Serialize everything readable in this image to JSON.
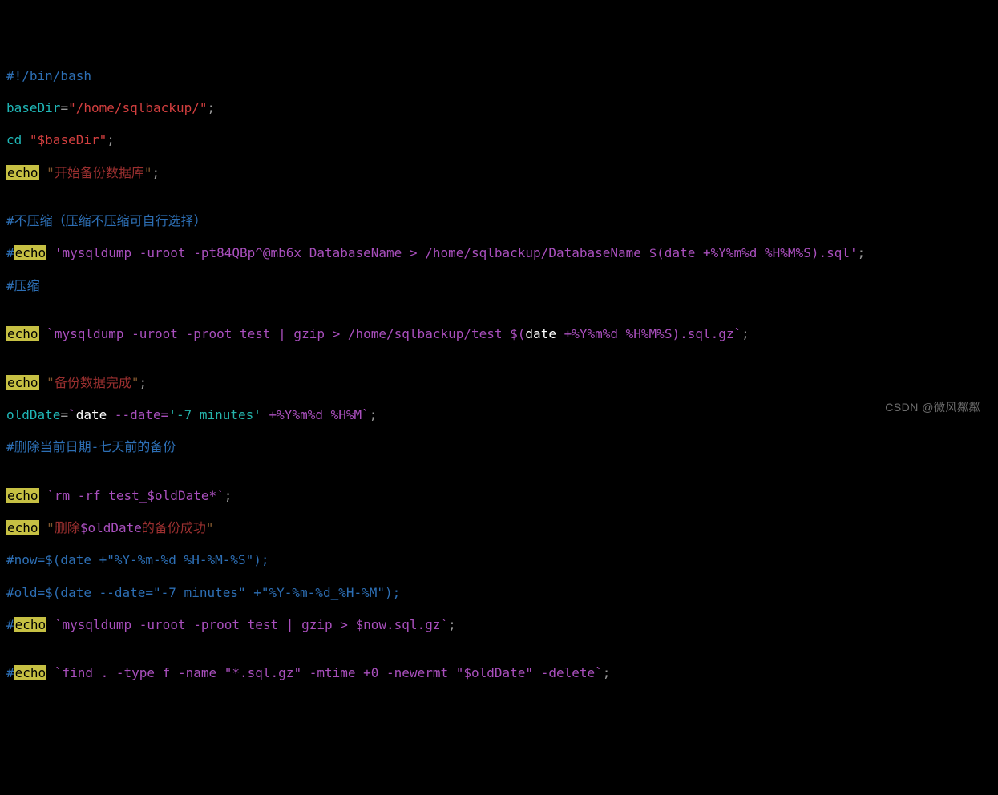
{
  "l1": {
    "shebang": "#!/bin/bash"
  },
  "l2": {
    "var": "baseDir",
    "eq": "=",
    "val": "\"/home/sqlbackup/\"",
    "semi": ";"
  },
  "l3": {
    "cd": "cd ",
    "arg": "\"$baseDir\"",
    "semi": ";"
  },
  "l4": {
    "echo": "echo",
    "sp": " ",
    "q1": "\"",
    "msg": "开始备份数据库",
    "q2": "\"",
    "semi": ";"
  },
  "blank1": "",
  "l6": {
    "text": "#不压缩（压缩不压缩可自行选择）"
  },
  "l7": {
    "hash": "#",
    "echo": "echo",
    "sp": " ",
    "str": "'mysqldump -uroot -pt84QBp^@mb6x DatabaseName > /home/sqlbackup/DatabaseName_$(date +%Y%m%d_%H%M%S).sql'",
    "semi": ";"
  },
  "l8": {
    "text": "#压缩"
  },
  "blank2": "",
  "l10": {
    "echo": "echo",
    "sp": " ",
    "bt1": "`",
    "cmd": "mysqldump -uroot -proot test | gzip > /home/sqlbackup/test_$(",
    "date": "date",
    "fmt": " +%Y%m%d_%H%M%S",
    "tail": ").sql.gz",
    "bt2": "`",
    "semi": ";"
  },
  "blank3": "",
  "l12": {
    "echo": "echo",
    "sp": " ",
    "q1": "\"",
    "msg": "备份数据完成",
    "q2": "\"",
    "semi": ";"
  },
  "l13": {
    "var": "oldDate",
    "eq": "=",
    "bt1": "`",
    "date": "date",
    "opt": " --date=",
    "arg": "'-7 minutes'",
    "fmt": " +%Y%m%d_%H%M",
    "bt2": "`",
    "semi": ";"
  },
  "l14": {
    "hash": "#",
    "msg": "删除当前日期-七天前的备份"
  },
  "blank4": "",
  "l16": {
    "echo": "echo",
    "sp": " ",
    "bt1": "`",
    "cmd": "rm -rf test_$oldDate*",
    "bt2": "`",
    "semi": ";"
  },
  "l17": {
    "echo": "echo",
    "sp": " ",
    "q1": "\"",
    "p1": "删除",
    "var": "$oldDate",
    "p2": "的备份成功",
    "q2": "\""
  },
  "l18": {
    "text": "#now=$(date +\"%Y-%m-%d_%H-%M-%S\");"
  },
  "l19": {
    "text": "#old=$(date --date=\"-7 minutes\" +\"%Y-%m-%d_%H-%M\");"
  },
  "l20": {
    "hash": "#",
    "echo": "echo",
    "sp": " ",
    "bt1": "`",
    "cmd": "mysqldump -uroot -proot test | gzip > $now.sql.gz",
    "bt2": "`",
    "semi": ";"
  },
  "blank5": "",
  "l22": {
    "hash": "#",
    "echo": "echo",
    "sp": " ",
    "bt1": "`",
    "cmd": "find . -type f -name \"*.sql.gz\" -mtime +0 -newermt \"$oldDate\" -delete",
    "bt2": "`",
    "semi": ";"
  },
  "watermark": "CSDN @微风粼粼"
}
